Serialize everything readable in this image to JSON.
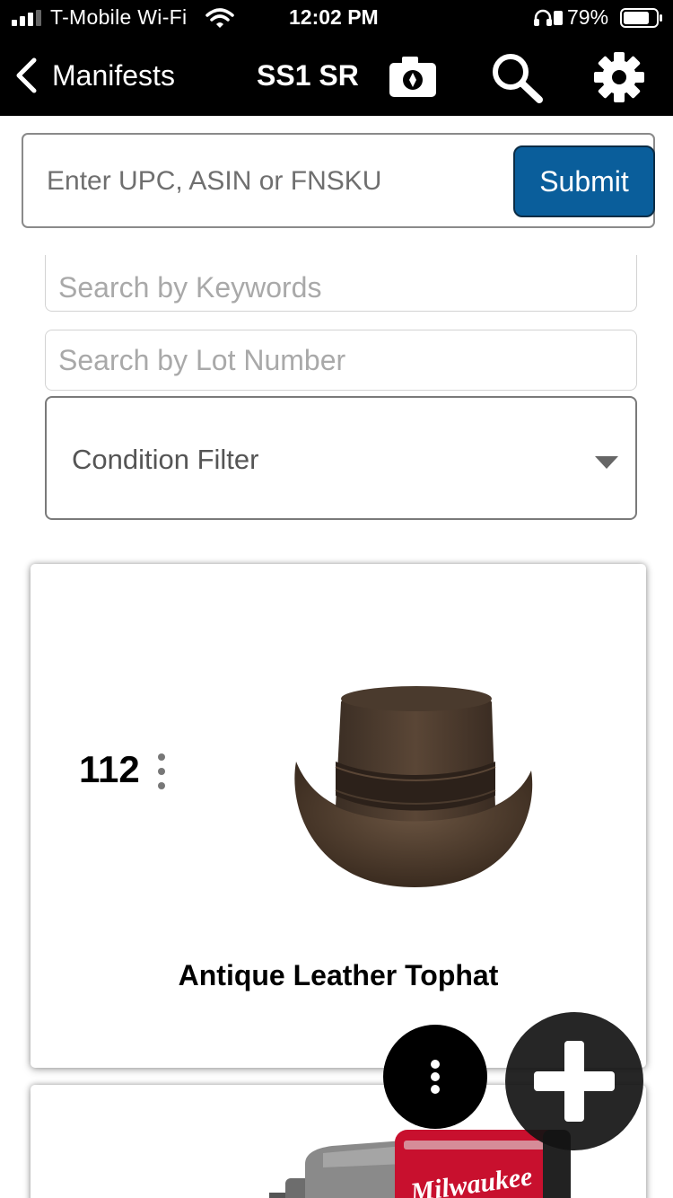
{
  "status_bar": {
    "carrier": "T-Mobile Wi-Fi",
    "time": "12:02 PM",
    "battery_percent": "79%",
    "battery_level": 0.79,
    "icons": [
      "signal-icon",
      "wifi-icon",
      "headphones-icon",
      "rotation-lock-icon",
      "battery-icon"
    ]
  },
  "navbar": {
    "back_label": "Manifests",
    "title": "SS1 SR",
    "icons": [
      "chevron-left-icon",
      "camera-scan-icon",
      "search-icon",
      "gear-icon"
    ]
  },
  "upc_form": {
    "placeholder": "Enter UPC, ASIN or FNSKU",
    "submit_label": "Submit",
    "submit_color": "#0a5e9b"
  },
  "filters": {
    "keyword_placeholder": "Search by Keywords",
    "lot_placeholder": "Search by Lot Number",
    "condition_label": "Condition Filter"
  },
  "items": [
    {
      "quantity": "112",
      "title": "Antique Leather Tophat",
      "image": "brown-leather-hat"
    },
    {
      "quantity": "",
      "title": "",
      "image": "red-black-impact-wrench",
      "image_brand_text": "Milwaukee"
    }
  ],
  "fabs": {
    "more_icon": "more-vertical-icon",
    "add_icon": "plus-icon"
  }
}
